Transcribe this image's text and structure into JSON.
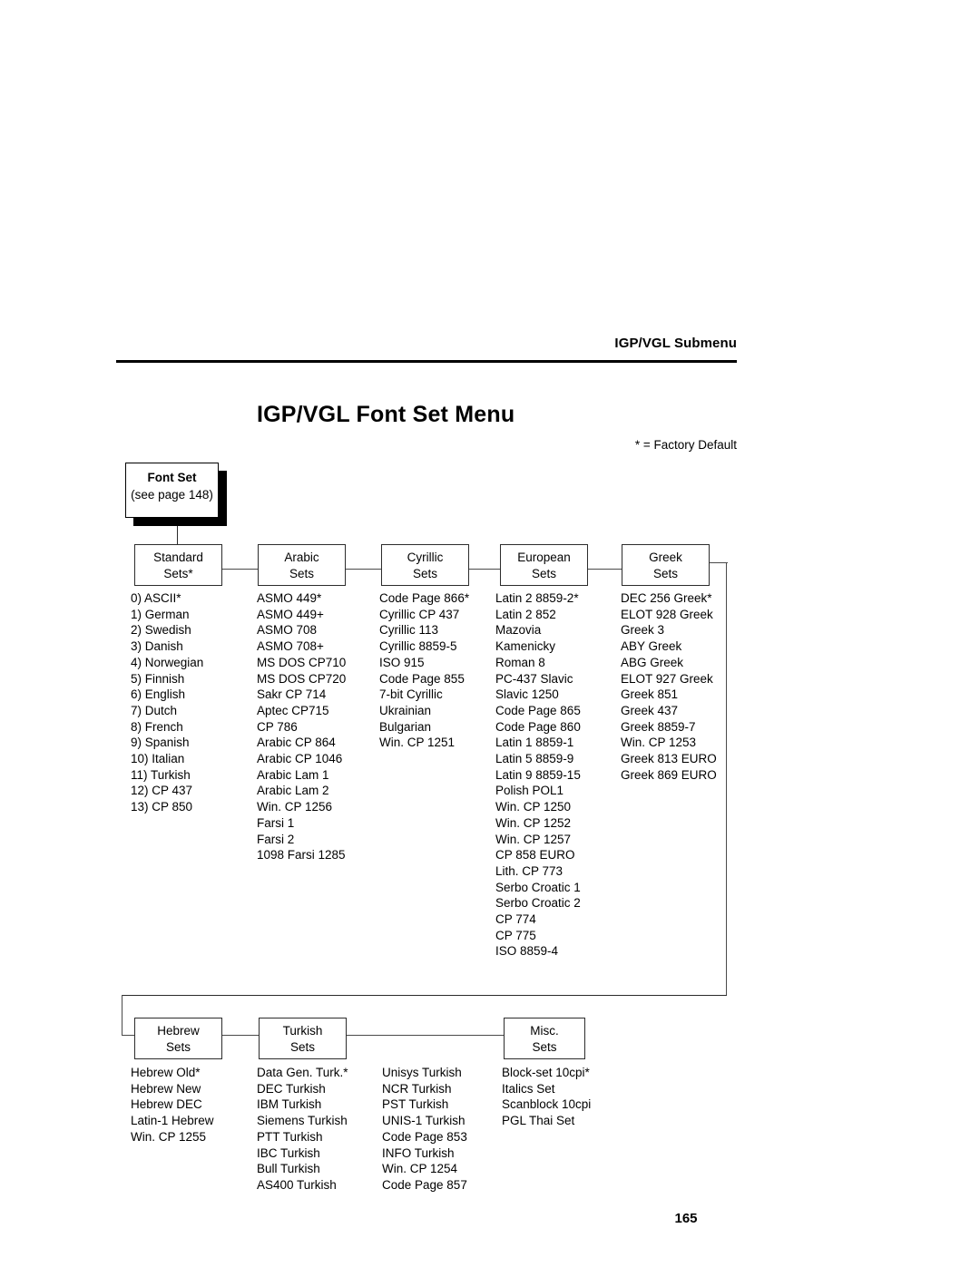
{
  "header": {
    "running_head": "IGP/VGL Submenu",
    "page_title": "IGP/VGL Font Set Menu",
    "factory_default_note": "* = Factory Default",
    "folio": "165"
  },
  "root": {
    "title": "Font Set",
    "reference": "(see page 148)"
  },
  "row1": [
    {
      "label_line1": "Standard",
      "label_line2": "Sets*",
      "options": [
        "0) ASCII*",
        "1) German",
        "2) Swedish",
        "3) Danish",
        "4) Norwegian",
        "5) Finnish",
        "6) English",
        "7) Dutch",
        "8) French",
        "9) Spanish",
        "10) Italian",
        "11) Turkish",
        "12) CP 437",
        "13) CP 850"
      ]
    },
    {
      "label_line1": "Arabic",
      "label_line2": "Sets",
      "options": [
        "ASMO 449*",
        "ASMO 449+",
        "ASMO 708",
        "ASMO 708+",
        "MS DOS CP710",
        "MS DOS CP720",
        "Sakr CP 714",
        "Aptec CP715",
        "CP 786",
        "Arabic CP 864",
        "Arabic CP 1046",
        "Arabic Lam 1",
        "Arabic Lam 2",
        "Win. CP 1256",
        "Farsi 1",
        "Farsi 2",
        "1098 Farsi 1285"
      ]
    },
    {
      "label_line1": "Cyrillic",
      "label_line2": "Sets",
      "options": [
        "Code Page 866*",
        "Cyrillic CP 437",
        "Cyrillic 113",
        "Cyrillic 8859-5",
        "ISO 915",
        "Code Page 855",
        "7-bit Cyrillic",
        "Ukrainian",
        "Bulgarian",
        "Win. CP 1251"
      ]
    },
    {
      "label_line1": "European",
      "label_line2": "Sets",
      "options": [
        "Latin 2 8859-2*",
        "Latin 2 852",
        "Mazovia",
        "Kamenicky",
        "Roman 8",
        "PC-437 Slavic",
        "Slavic 1250",
        "Code Page 865",
        "Code Page 860",
        "Latin 1 8859-1",
        "Latin 5 8859-9",
        "Latin 9 8859-15",
        "Polish POL1",
        "Win. CP 1250",
        "Win. CP 1252",
        "Win. CP 1257",
        "CP 858 EURO",
        "Lith. CP 773",
        "Serbo Croatic 1",
        "Serbo Croatic 2",
        "CP 774",
        "CP 775",
        "ISO 8859-4"
      ]
    },
    {
      "label_line1": "Greek",
      "label_line2": "Sets",
      "options": [
        "DEC 256 Greek*",
        "ELOT 928 Greek",
        "Greek 3",
        "ABY Greek",
        "ABG Greek",
        "ELOT 927 Greek",
        "Greek 851",
        "Greek 437",
        "Greek 8859-7",
        "Win. CP 1253",
        "Greek 813 EURO",
        "Greek 869 EURO"
      ]
    }
  ],
  "row2": [
    {
      "label_line1": "Hebrew",
      "label_line2": "Sets",
      "options": [
        "Hebrew Old*",
        "Hebrew New",
        "Hebrew DEC",
        "Latin-1 Hebrew",
        "Win. CP 1255"
      ]
    },
    {
      "label_line1": "Turkish",
      "label_line2": "Sets",
      "options": [
        "Data Gen. Turk.*",
        "DEC Turkish",
        "IBM Turkish",
        "Siemens Turkish",
        "PTT Turkish",
        "IBC Turkish",
        "Bull Turkish",
        "AS400 Turkish"
      ],
      "options_column2": [
        "Unisys Turkish",
        "NCR Turkish",
        "PST Turkish",
        "UNIS-1 Turkish",
        "Code Page 853",
        "INFO Turkish",
        "Win. CP 1254",
        "Code Page 857"
      ]
    },
    {
      "label_line1": "Misc.",
      "label_line2": "Sets",
      "options": [
        "Block-set 10cpi*",
        "Italics Set",
        "Scanblock 10cpi",
        "PGL Thai Set"
      ]
    }
  ]
}
